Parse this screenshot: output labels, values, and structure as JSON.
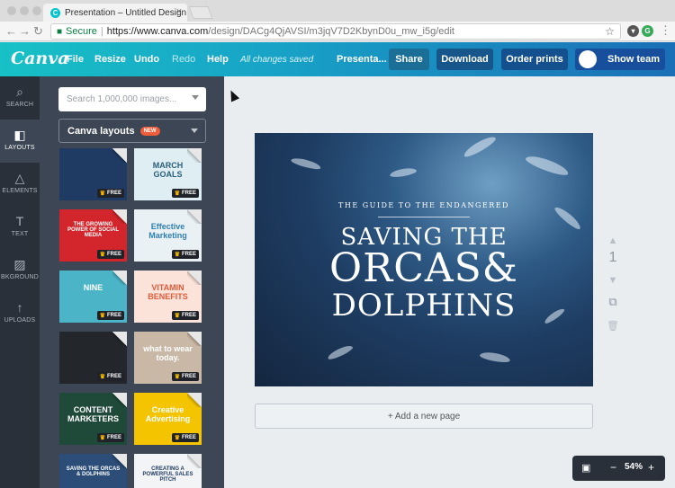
{
  "browser": {
    "tab_title": "Presentation – Untitled Design",
    "tab_close": "×",
    "secure_label": "Secure",
    "url_domain": "https://www.canva.com",
    "url_path": "/design/DACg4QjAVSI/m3jqV7D2KbynD0u_mw_i5g/edit"
  },
  "header": {
    "logo": "Canva",
    "menu": [
      "File",
      "Resize",
      "Undo",
      "Redo",
      "Help"
    ],
    "saved_status": "All changes saved",
    "doc_title": "Presenta...",
    "share": "Share",
    "download": "Download",
    "order_prints": "Order prints",
    "show_team": "Show team"
  },
  "rail": [
    {
      "label": "SEARCH",
      "icon": "search-icon",
      "glyph": "⌕"
    },
    {
      "label": "LAYOUTS",
      "icon": "layouts-icon",
      "glyph": "◧"
    },
    {
      "label": "ELEMENTS",
      "icon": "elements-icon",
      "glyph": "△"
    },
    {
      "label": "TEXT",
      "icon": "text-icon",
      "glyph": "T"
    },
    {
      "label": "BKGROUND",
      "icon": "background-icon",
      "glyph": "▨"
    },
    {
      "label": "UPLOADS",
      "icon": "uploads-icon",
      "glyph": "↑"
    }
  ],
  "panel": {
    "search_placeholder": "Search 1,000,000 images...",
    "layouts_label": "Canva layouts",
    "new_badge": "NEW",
    "free_label": "FREE",
    "thumbs": [
      {
        "text": "",
        "bg": "#1f3b63",
        "fg": "#ffffff"
      },
      {
        "text": "MARCH GOALS",
        "bg": "#dfeef2",
        "fg": "#2a5f7a"
      },
      {
        "text": "THE GROWING POWER OF SOCIAL MEDIA",
        "bg": "#d3262c",
        "fg": "#ffffff"
      },
      {
        "text": "Effective Marketing",
        "bg": "#e9f1f5",
        "fg": "#2f7fb0"
      },
      {
        "text": "NINE",
        "bg": "#4bb5c7",
        "fg": "#ffffff"
      },
      {
        "text": "VITAMIN BENEFITS",
        "bg": "#fbe3d9",
        "fg": "#e05b3a"
      },
      {
        "text": "",
        "bg": "#23272c",
        "fg": "#ffffff"
      },
      {
        "text": "what to wear today.",
        "bg": "#c9b8a6",
        "fg": "#ffffff"
      },
      {
        "text": "CONTENT MARKETERS",
        "bg": "#1f4a3a",
        "fg": "#ffffff"
      },
      {
        "text": "Creative Advertising",
        "bg": "#f4c400",
        "fg": "#ffffff"
      },
      {
        "text": "SAVING THE ORCAS & DOLPHINS",
        "bg": "#2b4d78",
        "fg": "#ffffff"
      },
      {
        "text": "CREATING A POWERFUL SALES PITCH",
        "bg": "#f3f4f6",
        "fg": "#1e3d63"
      }
    ]
  },
  "design": {
    "subtitle": "THE GUIDE TO THE ENDANGERED",
    "line1": "SAVING THE",
    "line2": "ORCAS&",
    "line3": "DOLPHINS"
  },
  "page_number": "1",
  "add_page": "+ Add a new page",
  "zoom": {
    "minus": "−",
    "value": "54%",
    "plus": "+"
  },
  "colors": {
    "accent": "#17c1c6",
    "brand_dark": "#293039",
    "panel": "#3d4654"
  }
}
